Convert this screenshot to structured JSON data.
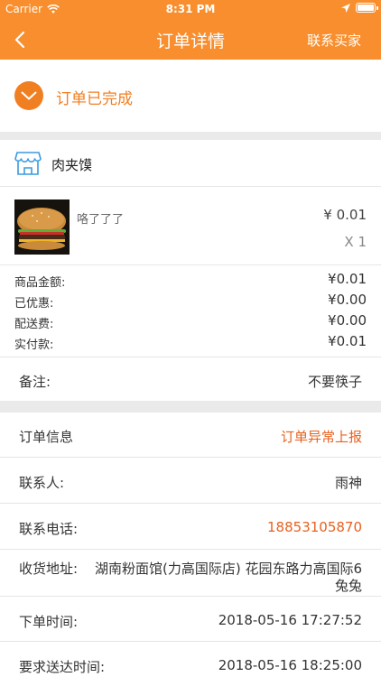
{
  "status_bar": {
    "carrier": "Carrier",
    "time": "8:31 PM"
  },
  "nav": {
    "title": "订单详情",
    "contact_seller": "联系买家"
  },
  "order_status": {
    "text": "订单已完成"
  },
  "shop": {
    "name": "肉夹馍"
  },
  "product": {
    "name": "咯了了了",
    "price": "¥ 0.01",
    "quantity": "X 1"
  },
  "fees": [
    {
      "label": "商品金额:",
      "value": "¥0.01"
    },
    {
      "label": "已优惠:",
      "value": "¥0.00"
    },
    {
      "label": "配送费:",
      "value": "¥0.00"
    },
    {
      "label": "实付款:",
      "value": "¥0.01"
    }
  ],
  "remark": {
    "label": "备注:",
    "value": "不要筷子"
  },
  "order_info": {
    "heading": "订单信息",
    "report_exception": "订单异常上报",
    "contact_label": "联系人:",
    "contact_name": "雨神",
    "phone_label": "联系电话:",
    "phone": "18853105870",
    "address_label": "收货地址:",
    "address_line1": "湖南粉面馆(力高国际店) 花园东路力高国际6",
    "address_line2": "兔兔",
    "order_time_label": "下单时间:",
    "order_time": "2018-05-16 17:27:52",
    "delivery_time_label": "要求送达时间:",
    "delivery_time": "2018-05-16 18:25:00"
  },
  "colors": {
    "primary": "#f88e2d",
    "accent": "#e8611e"
  }
}
